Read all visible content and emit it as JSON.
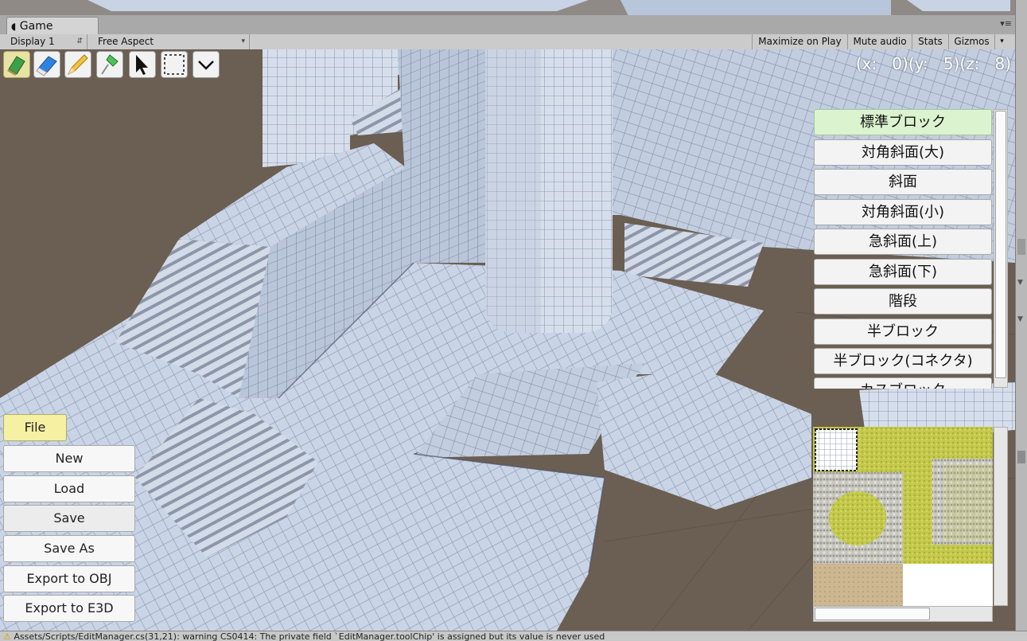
{
  "window": {
    "tab_label": "Game",
    "tab_icon": "pacman-game-icon"
  },
  "toolbar": {
    "display_select": "Display 1",
    "aspect_select": "Free Aspect",
    "maximize_label": "Maximize on Play",
    "mute_label": "Mute audio",
    "stats_label": "Stats",
    "gizmos_label": "Gizmos"
  },
  "tools": [
    {
      "name": "paint-block-tool",
      "icon": "green-block-pencil-icon",
      "selected": true
    },
    {
      "name": "eraser-tool",
      "icon": "blue-eraser-icon",
      "selected": false
    },
    {
      "name": "pencil-tool",
      "icon": "yellow-pencil-icon",
      "selected": false
    },
    {
      "name": "fill-tool",
      "icon": "green-pin-icon",
      "selected": false
    },
    {
      "name": "select-tool",
      "icon": "arrow-cursor-icon",
      "selected": false
    },
    {
      "name": "rect-select-tool",
      "icon": "dashed-rectangle-icon",
      "selected": false
    },
    {
      "name": "expand-tool",
      "icon": "chevron-down-icon",
      "selected": false
    }
  ],
  "coordinates": {
    "text": "(x:   0)(y:   5)(z:   8)"
  },
  "block_list": {
    "items": [
      {
        "label": "標準ブロック",
        "selected": true
      },
      {
        "label": "対角斜面(大)",
        "selected": false
      },
      {
        "label": "斜面",
        "selected": false
      },
      {
        "label": "対角斜面(小)",
        "selected": false
      },
      {
        "label": "急斜面(上)",
        "selected": false
      },
      {
        "label": "急斜面(下)",
        "selected": false
      },
      {
        "label": "階段",
        "selected": false
      },
      {
        "label": "半ブロック",
        "selected": false
      },
      {
        "label": "半ブロック(コネクタ)",
        "selected": false
      },
      {
        "label": "カスブロック",
        "selected": false
      }
    ]
  },
  "file_menu": {
    "file_label": "File",
    "new_label": "New",
    "load_label": "Load",
    "save_label": "Save",
    "save_as_label": "Save As",
    "export_obj_label": "Export to OBJ",
    "export_e3d_label": "Export to E3D"
  },
  "status": {
    "message": "Assets/Scripts/EditManager.cs(31,21): warning CS0414: The private field `EditManager.toolChip' is assigned but its value is never used"
  },
  "colors": {
    "selected_tool": "#e7e3a3",
    "selected_block": "#dcf3cf",
    "file_button": "#f5f0a2",
    "viewport_background": "#6b5e52",
    "tile_surface": "#c7d3e6"
  }
}
